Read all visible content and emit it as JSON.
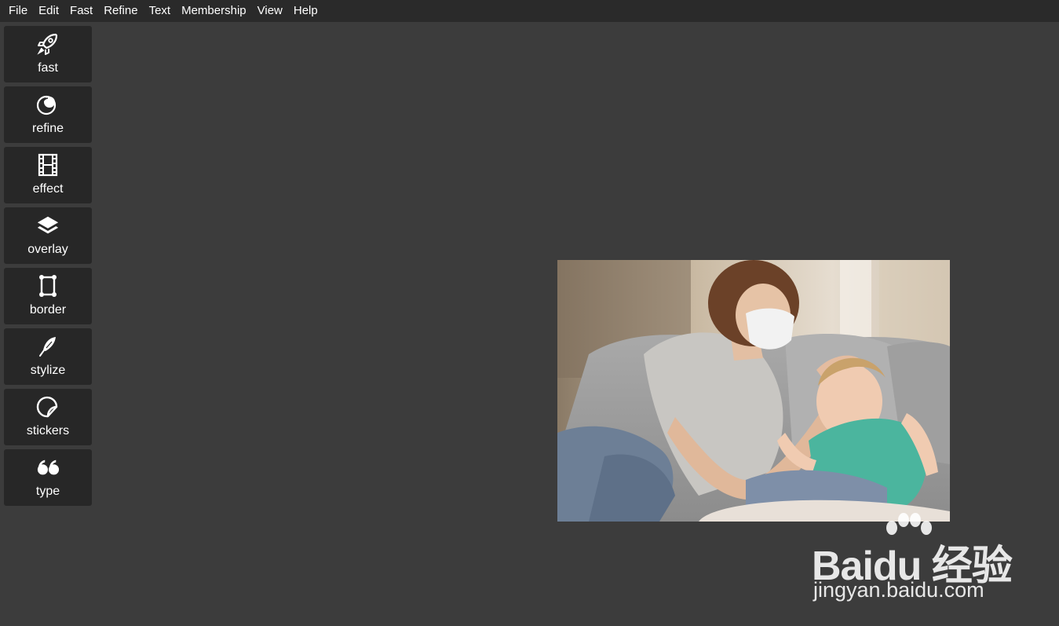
{
  "menubar": {
    "items": [
      "File",
      "Edit",
      "Fast",
      "Refine",
      "Text",
      "Membership",
      "View",
      "Help"
    ]
  },
  "sidebar": {
    "tools": [
      {
        "label": "fast",
        "icon": "rocket-icon"
      },
      {
        "label": "refine",
        "icon": "refine-circles-icon"
      },
      {
        "label": "effect",
        "icon": "film-icon"
      },
      {
        "label": "overlay",
        "icon": "layers-icon"
      },
      {
        "label": "border",
        "icon": "border-frame-icon"
      },
      {
        "label": "stylize",
        "icon": "feather-icon"
      },
      {
        "label": "stickers",
        "icon": "sticker-icon"
      },
      {
        "label": "type",
        "icon": "quote-icon"
      }
    ]
  },
  "canvas": {
    "image_subject": "photo-of-masked-woman-caring-for-child-on-sofa"
  },
  "watermark": {
    "brand": "Baidu 经验",
    "url": "jingyan.baidu.com"
  },
  "colors": {
    "background": "#3c3c3c",
    "menubar": "#2a2a2a",
    "tool_button": "#272727",
    "text": "#ffffff"
  }
}
